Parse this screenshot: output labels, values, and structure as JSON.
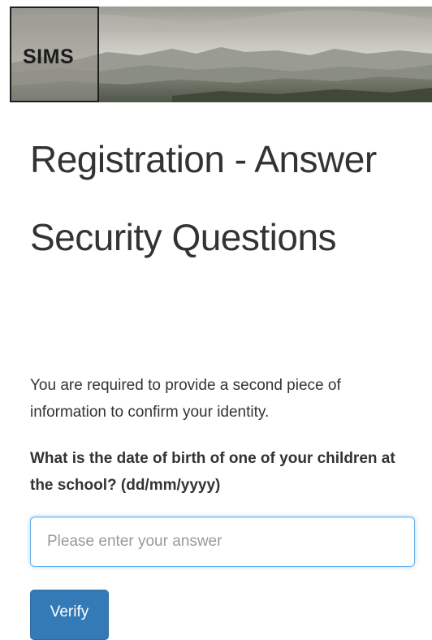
{
  "header": {
    "logo_text": "SIMS"
  },
  "page": {
    "title": "Registration - Answer Security Questions",
    "intro": "You are required to provide a second piece of information to confirm your identity."
  },
  "form": {
    "question": "What is the date of birth of one of your children at the school? (dd/mm/yyyy)",
    "answer_value": "",
    "answer_placeholder": "Please enter your answer",
    "verify_label": "Verify"
  },
  "colors": {
    "button_primary": "#337ab7",
    "input_focus_border": "#66afe9",
    "text": "#333333"
  }
}
